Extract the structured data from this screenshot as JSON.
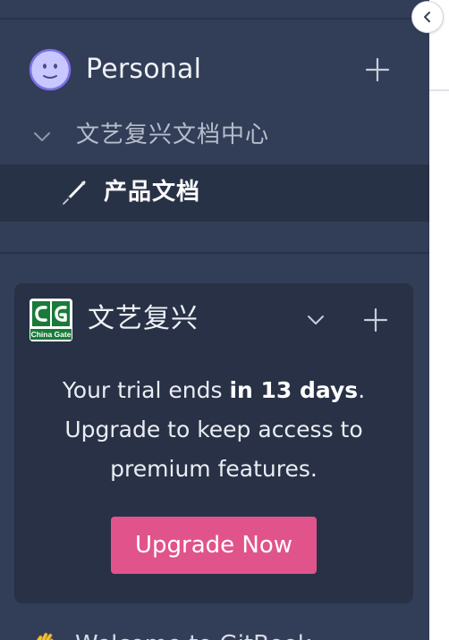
{
  "space": {
    "title": "Personal",
    "avatar_icon": "smiley-face-icon",
    "add_icon": "plus-icon"
  },
  "collection": {
    "label": "文艺复兴文档中心",
    "chevron_icon": "chevron-down-icon"
  },
  "document": {
    "label": "产品文档",
    "icon": "pen-icon"
  },
  "organization": {
    "name": "文艺复兴",
    "logo_text_main": "CG",
    "logo_text_sub": "China Gate",
    "chevron_icon": "chevron-down-icon",
    "add_icon": "plus-icon"
  },
  "trial": {
    "prefix": "Your trial ends ",
    "highlight": "in 13 days",
    "suffix": ".",
    "line2": "Upgrade to keep access to",
    "line3": "premium features."
  },
  "upgrade": {
    "label": "Upgrade Now"
  },
  "welcome": {
    "label": "Welcome to GitBook",
    "icon": "waving-hand-icon"
  },
  "colors": {
    "sidebar_bg": "#323d57",
    "selected_row_bg": "#283247",
    "card_bg": "#283145",
    "accent_pink": "#e0548b",
    "logo_green": "#1a7a3a"
  }
}
